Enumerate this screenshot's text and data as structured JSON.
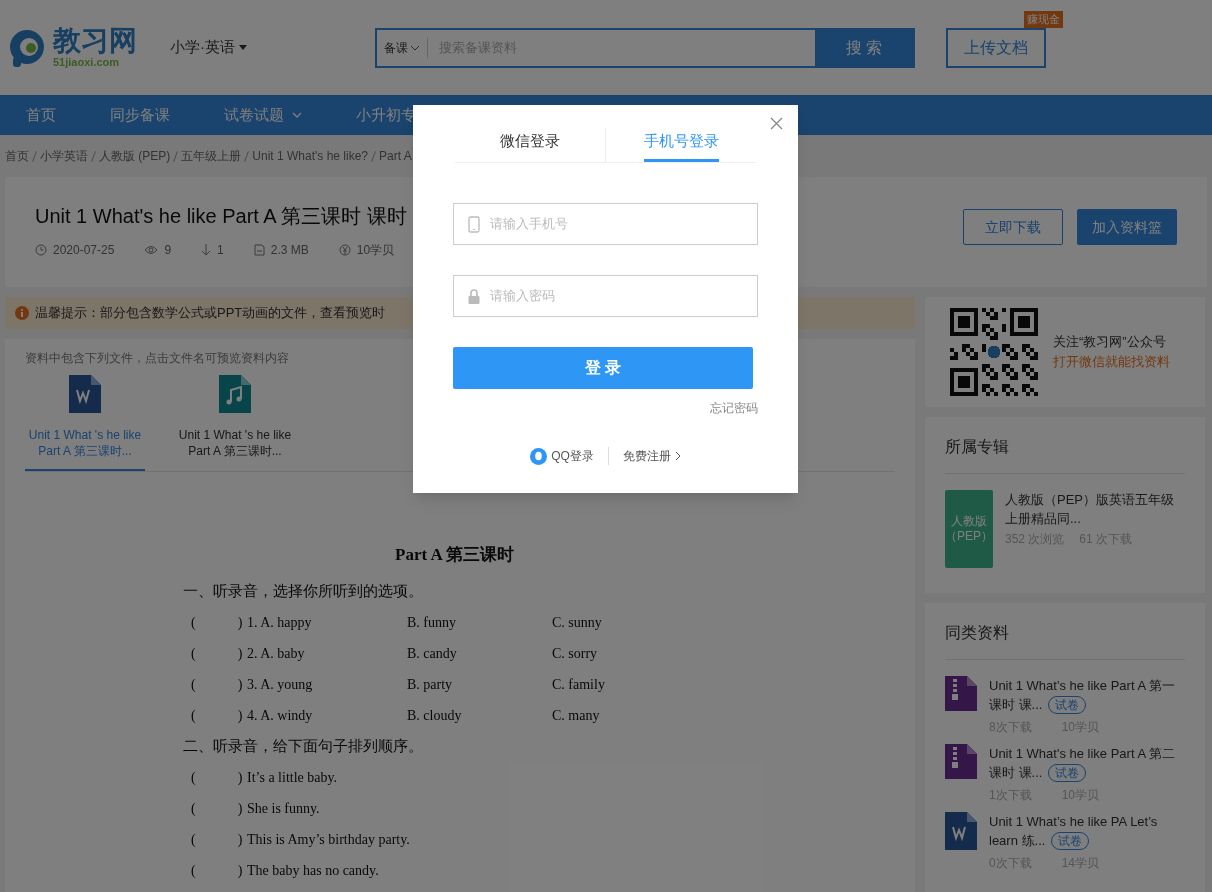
{
  "header": {
    "logo_text": "教习网",
    "logo_sub": "51jiaoxi.com",
    "subject": "小学·英语",
    "search": {
      "category": "备课",
      "placeholder": "搜索备课资料",
      "button": "搜 索"
    },
    "upload": "上传文档",
    "upload_badge": "赚现金"
  },
  "nav": [
    {
      "label": "首页",
      "dropdown": false
    },
    {
      "label": "同步备课",
      "dropdown": false
    },
    {
      "label": "试卷试题",
      "dropdown": true
    },
    {
      "label": "小升初专",
      "dropdown": false
    }
  ],
  "breadcrumb": [
    "首页",
    "小学英语",
    "人教版 (PEP)",
    "五年级上册",
    "Unit 1 What's he like?",
    "Part A"
  ],
  "resource": {
    "title": "Unit 1 What's he like Part A 第三课时 课时",
    "meta": [
      {
        "kind": "date",
        "text": "2020-07-25"
      },
      {
        "kind": "views",
        "text": "9"
      },
      {
        "kind": "downloads",
        "text": "1"
      },
      {
        "kind": "size",
        "text": "2.3 MB"
      },
      {
        "kind": "price",
        "text": "10学贝"
      }
    ],
    "download": "立即下载",
    "add": "加入资料篮"
  },
  "tip": "温馨提示：部分包含数学公式或PPT动画的文件，查看预览时",
  "files": {
    "hint": "资料中包含下列文件，点击文件名可预览资料内容",
    "items": [
      {
        "kind": "word",
        "name": "Unit 1 What 's he like Part A 第三课时...",
        "selected": true
      },
      {
        "kind": "audio",
        "name": "Unit 1 What 's he like Part A 第三课时...",
        "selected": false
      }
    ]
  },
  "document": {
    "title": "Part A  第三课时",
    "sections": [
      {
        "heading": "一、听录音，选择你所听到的选项。",
        "rows": [
          {
            "paren": "(　　　)",
            "cells": [
              "1. A. happy",
              "B. funny",
              "C. sunny"
            ]
          },
          {
            "paren": "(　　　)",
            "cells": [
              "2. A. baby",
              "B. candy",
              "C. sorry"
            ]
          },
          {
            "paren": "(　　　)",
            "cells": [
              "3. A. young",
              "B. party",
              "C. family"
            ]
          },
          {
            "paren": "(　　　)",
            "cells": [
              "4. A. windy",
              "B. cloudy",
              "C. many"
            ]
          }
        ]
      },
      {
        "heading": "二、听录音，给下面句子排列顺序。",
        "rows": [
          {
            "paren": "(　　　)",
            "cells": [
              "It’s a little  baby."
            ]
          },
          {
            "paren": "(　　　)",
            "cells": [
              "She is funny."
            ]
          },
          {
            "paren": "(　　　)",
            "cells": [
              "This is Amy’s birthday party."
            ]
          },
          {
            "paren": "(　　　)",
            "cells": [
              "The baby has no candy."
            ]
          }
        ]
      }
    ]
  },
  "wechat": {
    "line1": "关注“教习网”公众号",
    "line2": "打开微信就能找资料"
  },
  "album": {
    "heading": "所属专辑",
    "cover_label": "人教版（PEP）",
    "title": "人教版（PEP）版英语五年级上册精品同...",
    "views": "352 次浏览",
    "downloads": "61 次下载"
  },
  "similar": {
    "heading": "同类资料",
    "items": [
      {
        "kind": "zip",
        "title": "Unit 1 What's he like Part A 第一课时 课...",
        "tag": "试卷",
        "downloads": "8次下载",
        "price": "10学贝"
      },
      {
        "kind": "zip",
        "title": "Unit 1 What's he like Part A 第二课时 课...",
        "tag": "试卷",
        "downloads": "1次下载",
        "price": "10学贝"
      },
      {
        "kind": "word",
        "title": "Unit 1 What’s he like PA Let’s learn 练...",
        "tag": "试卷",
        "downloads": "0次下载",
        "price": "14学贝"
      }
    ]
  },
  "login": {
    "tabs": [
      {
        "label": "微信登录",
        "selected": false
      },
      {
        "label": "手机号登录",
        "selected": true
      }
    ],
    "phone_placeholder": "请输入手机号",
    "password_placeholder": "请输入密码",
    "submit": "登 录",
    "forgot": "忘记密码",
    "qq": "QQ登录",
    "register": "免费注册"
  }
}
